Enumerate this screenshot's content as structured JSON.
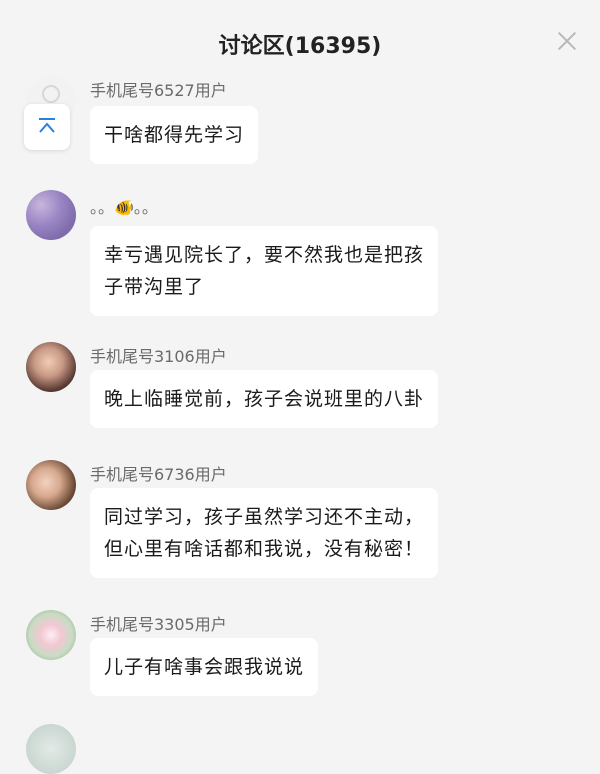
{
  "header": {
    "title": "讨论区(16395)"
  },
  "comments": [
    {
      "name": "手机尾号6527用户",
      "lines": [
        "干啥都得先学习"
      ]
    },
    {
      "name": "。。🐠。。",
      "lines": [
        "幸亏遇见院长了，要不然我也是把孩",
        "子带沟里了"
      ]
    },
    {
      "name": "手机尾号3106用户",
      "lines": [
        "晚上临睡觉前，孩子会说班里的八卦"
      ]
    },
    {
      "name": "手机尾号6736用户",
      "lines": [
        "同过学习，孩子虽然学习还不主动，",
        "但心里有啥话都和我说，没有秘密！"
      ]
    },
    {
      "name": "手机尾号3305用户",
      "lines": [
        "儿子有啥事会跟我说说"
      ]
    }
  ],
  "icons": {
    "close": "close-icon",
    "scroll_top": "arrow-up-to-top-icon",
    "default_avatar": "default-user-icon"
  },
  "colors": {
    "background": "#f4f4f4",
    "bubble": "#ffffff",
    "username": "#6a6a6a",
    "scroll_top_arrow": "#2c7fe0"
  }
}
